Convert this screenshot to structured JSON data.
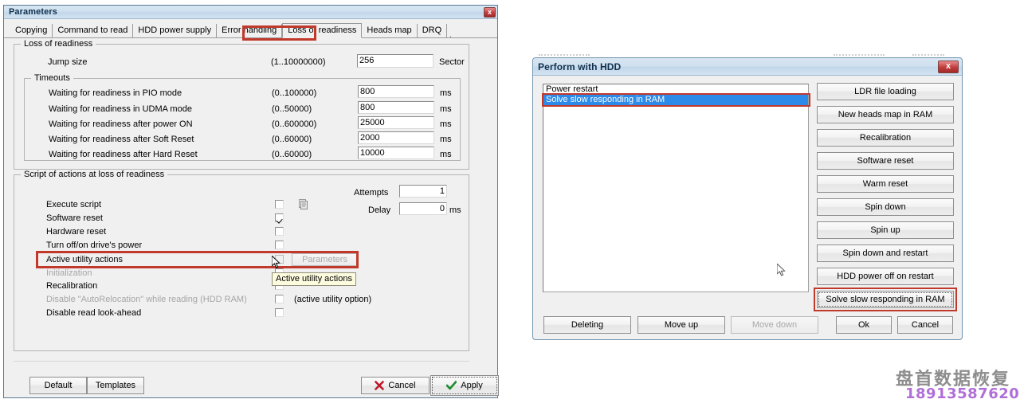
{
  "parameters_window": {
    "title": "Parameters",
    "close_label": "x",
    "tabs": [
      {
        "label": "Copying",
        "selected": false
      },
      {
        "label": "Command to read",
        "selected": false
      },
      {
        "label": "HDD power supply",
        "selected": false
      },
      {
        "label": "Error handling",
        "selected": false
      },
      {
        "label": "Loss of readiness",
        "selected": true
      },
      {
        "label": "Heads map",
        "selected": false
      },
      {
        "label": "DRQ",
        "selected": false
      }
    ],
    "loss_group": {
      "legend": "Loss of readiness",
      "jump_size": {
        "label": "Jump size",
        "range": "(1..10000000)",
        "value": "256",
        "unit": "Sector"
      },
      "timeouts": {
        "legend": "Timeouts",
        "rows": [
          {
            "label": "Waiting for readiness in PIO mode",
            "range": "(0..100000)",
            "value": "800",
            "unit": "ms"
          },
          {
            "label": "Waiting for readiness in UDMA mode",
            "range": "(0..50000)",
            "value": "800",
            "unit": "ms"
          },
          {
            "label": "Waiting for readiness after power ON",
            "range": "(0..600000)",
            "value": "25000",
            "unit": "ms"
          },
          {
            "label": "Waiting for readiness after Soft Reset",
            "range": "(0..60000)",
            "value": "2000",
            "unit": "ms"
          },
          {
            "label": "Waiting for readiness after Hard Reset",
            "range": "(0..60000)",
            "value": "10000",
            "unit": "ms"
          }
        ]
      }
    },
    "script_group": {
      "legend": "Script of actions at loss of readiness",
      "attempts": {
        "label": "Attempts",
        "value": "1"
      },
      "delay": {
        "label": "Delay",
        "value": "0",
        "unit": "ms"
      },
      "rows": [
        {
          "label": "Execute script",
          "checked": false,
          "disabled": false,
          "note": ""
        },
        {
          "label": "Software reset",
          "checked": true,
          "disabled": false,
          "note": ""
        },
        {
          "label": "Hardware reset",
          "checked": false,
          "disabled": false,
          "note": ""
        },
        {
          "label": "Turn off/on drive's power",
          "checked": false,
          "disabled": false,
          "note": ""
        },
        {
          "label": "Active utility actions",
          "checked": false,
          "disabled": false,
          "note": ""
        },
        {
          "label": "Initialization",
          "checked": false,
          "disabled": true,
          "note": ""
        },
        {
          "label": "Recalibration",
          "checked": false,
          "disabled": false,
          "note": ""
        },
        {
          "label": "Disable \"AutoRelocation\" while reading (HDD RAM)",
          "checked": false,
          "disabled": true,
          "note": "(active utility option)"
        },
        {
          "label": "Disable read look-ahead",
          "checked": false,
          "disabled": false,
          "note": ""
        }
      ],
      "parameters_button": "Parameters",
      "tooltip": "Active utility actions"
    },
    "footer": {
      "default_label": "Default",
      "templates_label": "Templates",
      "cancel_label": "Cancel",
      "apply_label": "Apply"
    }
  },
  "perform_window": {
    "title": "Perform with HDD",
    "close_label": "x",
    "list_items": [
      {
        "label": "Power restart",
        "selected": false
      },
      {
        "label": "Solve slow responding in RAM",
        "selected": true
      }
    ],
    "action_buttons": [
      "LDR file loading",
      "New heads map in RAM",
      "Recalibration",
      "Software reset",
      "Warm reset",
      "Spin down",
      "Spin up",
      "Spin down and restart",
      "HDD power off on restart",
      "Solve slow responding in RAM"
    ],
    "footer_buttons": [
      {
        "label": "Deleting",
        "disabled": false
      },
      {
        "label": "Move up",
        "disabled": false
      },
      {
        "label": "Move down",
        "disabled": true
      },
      {
        "label": "Ok",
        "disabled": false
      },
      {
        "label": "Cancel",
        "disabled": false
      }
    ]
  },
  "watermark": {
    "text_cn": "盘首数据恢复",
    "phone": "18913587620"
  },
  "colors": {
    "highlight_red": "#c0392b",
    "selection_blue": "#2c8ae8",
    "title_gradient_top": "#d8e6f2",
    "watermark_gray": "#8d8d8d",
    "watermark_purple": "#b06fd8"
  }
}
